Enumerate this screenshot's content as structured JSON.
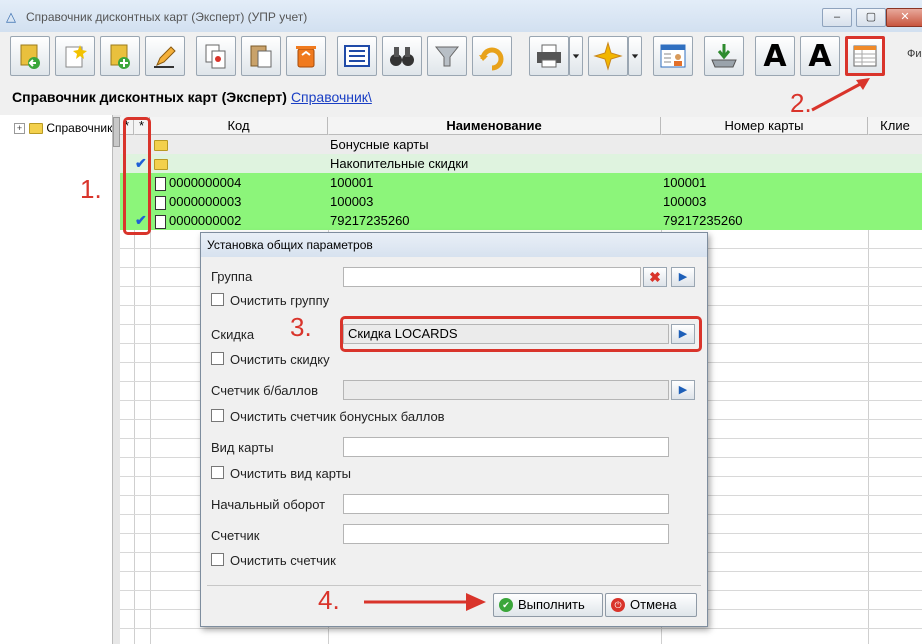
{
  "window": {
    "title": "Справочник дисконтных карт (Эксперт) (УПР учет)",
    "min_symbol": "–",
    "max_symbol": "▢",
    "close_symbol": "✕"
  },
  "toolbar": {
    "buttons": [
      {
        "icon": "folder-back-icon"
      },
      {
        "icon": "new-item-icon"
      },
      {
        "icon": "folder-add-icon"
      },
      {
        "icon": "edit-pencil-icon"
      },
      {
        "icon": "copy-document-icon"
      },
      {
        "icon": "paste-icon"
      },
      {
        "icon": "recycle-bin-icon"
      },
      {
        "icon": "list-view-icon"
      },
      {
        "icon": "binoculars-icon"
      },
      {
        "icon": "filter-funnel-icon"
      },
      {
        "icon": "refresh-arrow-icon"
      },
      {
        "icon": "printer-icon"
      },
      {
        "icon": "sparkle-icon"
      },
      {
        "icon": "user-card-icon"
      },
      {
        "icon": "download-tray-icon"
      },
      {
        "icon": "font-increase-icon"
      },
      {
        "icon": "font-decrease-icon"
      },
      {
        "icon": "table-settings-icon"
      }
    ],
    "glyph_font_increase": "A",
    "glyph_font_decrease": "A",
    "tail_text": "Фи"
  },
  "breadcrumb": {
    "title": "Справочник дисконтных карт (Эксперт)",
    "link": "Справочник\\"
  },
  "tree": {
    "root_label": "Справочник",
    "expander": "+"
  },
  "grid": {
    "headers": {
      "mark": "*",
      "mark2": "*",
      "code": "Код",
      "name": "Наименование",
      "card_number": "Номер карты",
      "client": "Клие"
    },
    "rows": [
      {
        "checked": false,
        "kind": "folder",
        "code": "",
        "name": "Бонусные карты",
        "card_number": ""
      },
      {
        "checked": true,
        "kind": "folder",
        "code": "",
        "name": "Накопительные скидки",
        "card_number": ""
      },
      {
        "checked": false,
        "kind": "doc",
        "code": "0000000004",
        "name": "100001",
        "card_number": "100001"
      },
      {
        "checked": false,
        "kind": "doc",
        "code": "0000000003",
        "name": "100003",
        "card_number": "100003"
      },
      {
        "checked": true,
        "kind": "doc",
        "code": "0000000002",
        "name": "79217235260",
        "card_number": "79217235260"
      }
    ],
    "check_glyph": "✔"
  },
  "dialog": {
    "title": "Установка общих параметров",
    "group_label": "Группа",
    "group_value": "",
    "clear_group": "Очистить группу",
    "discount_label": "Скидка",
    "discount_value": "Скидка LOCARDS",
    "clear_discount": "Очистить скидку",
    "bonus_counter_label": "Счетчик б/баллов",
    "bonus_counter_value": "",
    "clear_bonus_counter": "Очистить счетчик бонусных баллов",
    "card_type_label": "Вид карты",
    "card_type_value": "",
    "clear_card_type": "Очистить вид карты",
    "initial_turnover_label": "Начальный оборот",
    "initial_turnover_value": "",
    "counter_label": "Счетчик",
    "counter_value": "",
    "clear_counter": "Очистить счетчик",
    "select_glyph": "▶",
    "clear_glyph": "✖",
    "execute_label": "Выполнить",
    "cancel_label": "Отмена",
    "execute_icon_glyph": "✔",
    "cancel_icon_glyph": "⏻"
  },
  "annotations": {
    "step1": "1.",
    "step2": "2.",
    "step3": "3.",
    "step4": "4.",
    "color": "#d9342b"
  },
  "colors": {
    "row_highlight": "#8cf57a",
    "group_row": "#ececec",
    "group_row_checked": "#dff3df",
    "link": "#1a3fc4",
    "check": "#1f5fd6"
  }
}
